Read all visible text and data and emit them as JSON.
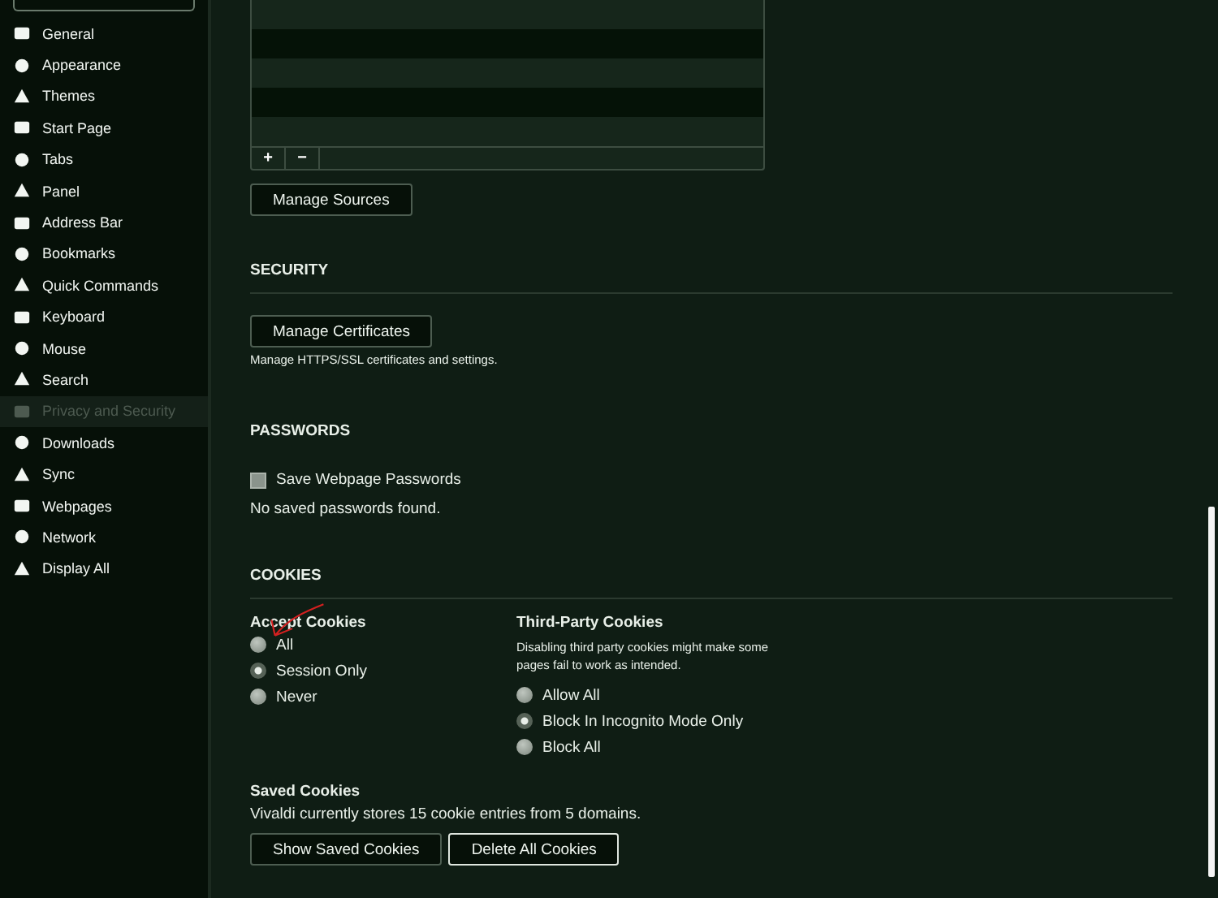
{
  "sidebar": {
    "items": [
      {
        "label": "General",
        "selected": false
      },
      {
        "label": "Appearance",
        "selected": false
      },
      {
        "label": "Themes",
        "selected": false
      },
      {
        "label": "Start Page",
        "selected": false
      },
      {
        "label": "Tabs",
        "selected": false
      },
      {
        "label": "Panel",
        "selected": false
      },
      {
        "label": "Address Bar",
        "selected": false
      },
      {
        "label": "Bookmarks",
        "selected": false
      },
      {
        "label": "Quick Commands",
        "selected": false
      },
      {
        "label": "Keyboard",
        "selected": false
      },
      {
        "label": "Mouse",
        "selected": false
      },
      {
        "label": "Search",
        "selected": false
      },
      {
        "label": "Privacy and Security",
        "selected": true
      },
      {
        "label": "Downloads",
        "selected": false
      },
      {
        "label": "Sync",
        "selected": false
      },
      {
        "label": "Webpages",
        "selected": false
      },
      {
        "label": "Network",
        "selected": false
      },
      {
        "label": "Display All",
        "selected": false
      }
    ]
  },
  "sources": {
    "list_buttons": [
      "+",
      "−"
    ],
    "manage_button": "Manage Sources"
  },
  "security": {
    "heading": "SECURITY",
    "button": "Manage Certificates",
    "description": "Manage HTTPS/SSL certificates and settings."
  },
  "passwords": {
    "heading": "PASSWORDS",
    "save_passwords": {
      "label": "Save Webpage Passwords",
      "checked": false
    },
    "status": "No saved passwords found."
  },
  "cookies": {
    "heading": "COOKIES",
    "accept": {
      "title": "Accept Cookies",
      "options": [
        {
          "label": "All",
          "selected": false
        },
        {
          "label": "Session Only",
          "selected": true
        },
        {
          "label": "Never",
          "selected": false
        }
      ]
    },
    "third_party": {
      "title": "Third-Party Cookies",
      "description": "Disabling third party cookies might make some pages fail to work as intended.",
      "options": [
        {
          "label": "Allow All",
          "selected": false
        },
        {
          "label": "Block In Incognito Mode Only",
          "selected": true
        },
        {
          "label": "Block All",
          "selected": false
        }
      ]
    },
    "saved": {
      "title": "Saved Cookies",
      "text": "Vivaldi currently stores 15 cookie entries from 5 domains.",
      "buttons": [
        "Show Saved Cookies",
        "Delete All Cookies"
      ]
    }
  }
}
